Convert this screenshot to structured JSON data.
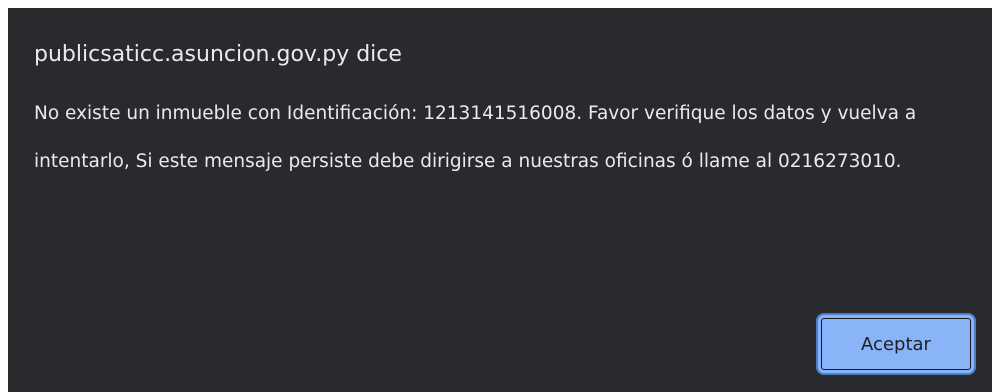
{
  "dialog": {
    "title": "publicsaticc.asuncion.gov.py dice",
    "message": "No existe un inmueble con Identificación: 1213141516008. Favor verifique los datos y vuelva a intentarlo, Si este mensaje persiste debe dirigirse a nuestras oficinas ó llame al 0216273010.",
    "accept_label": "Aceptar"
  },
  "colors": {
    "background": "#292a2d",
    "text": "#e8eaed",
    "button": "#8ab4f8",
    "button_border": "#4d80c8"
  }
}
